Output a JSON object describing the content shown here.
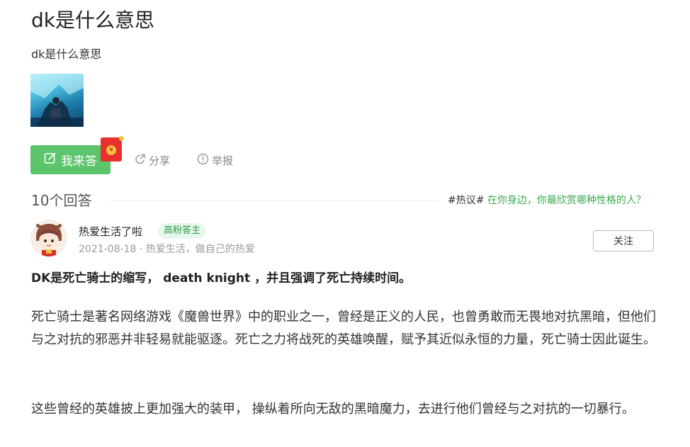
{
  "question": {
    "title": "dk是什么意思",
    "description": "dk是什么意思"
  },
  "actions": {
    "answer_label": "我来答",
    "redpacket_glyph": "¥",
    "share_label": "分享",
    "report_label": "举报"
  },
  "answers_header": {
    "count_label": "10个回答",
    "hot_tag": "#热议#",
    "hot_link": "在你身边，你最欣赏哪种性格的人？"
  },
  "answer": {
    "author": "热爱生活了啦",
    "badge": "高粉答主",
    "meta": "2021-08-18 · 热爱生活，做自己的热爱",
    "follow_label": "关注",
    "paragraphs": [
      "DK是死亡骑士的缩写， death knight ，并且强调了死亡持续时间。",
      "死亡骑士是著名网络游戏《魔兽世界》中的职业之一，曾经是正义的人民，也曾勇敢而无畏地对抗黑暗，但他们与之对抗的邪恶并非轻易就能驱逐。死亡之力将战死的英雄唤醒，赋予其近似永恒的力量，死亡骑士因此诞生。",
      "这些曾经的英雄披上更加强大的装甲， 操纵着所向无敌的黑暗魔力，去进行他们曾经与之对抗的一切暴行。"
    ]
  },
  "colors": {
    "accent_green": "#5cc46b",
    "link_green": "#39a94e",
    "redpacket": "#e8312d"
  }
}
